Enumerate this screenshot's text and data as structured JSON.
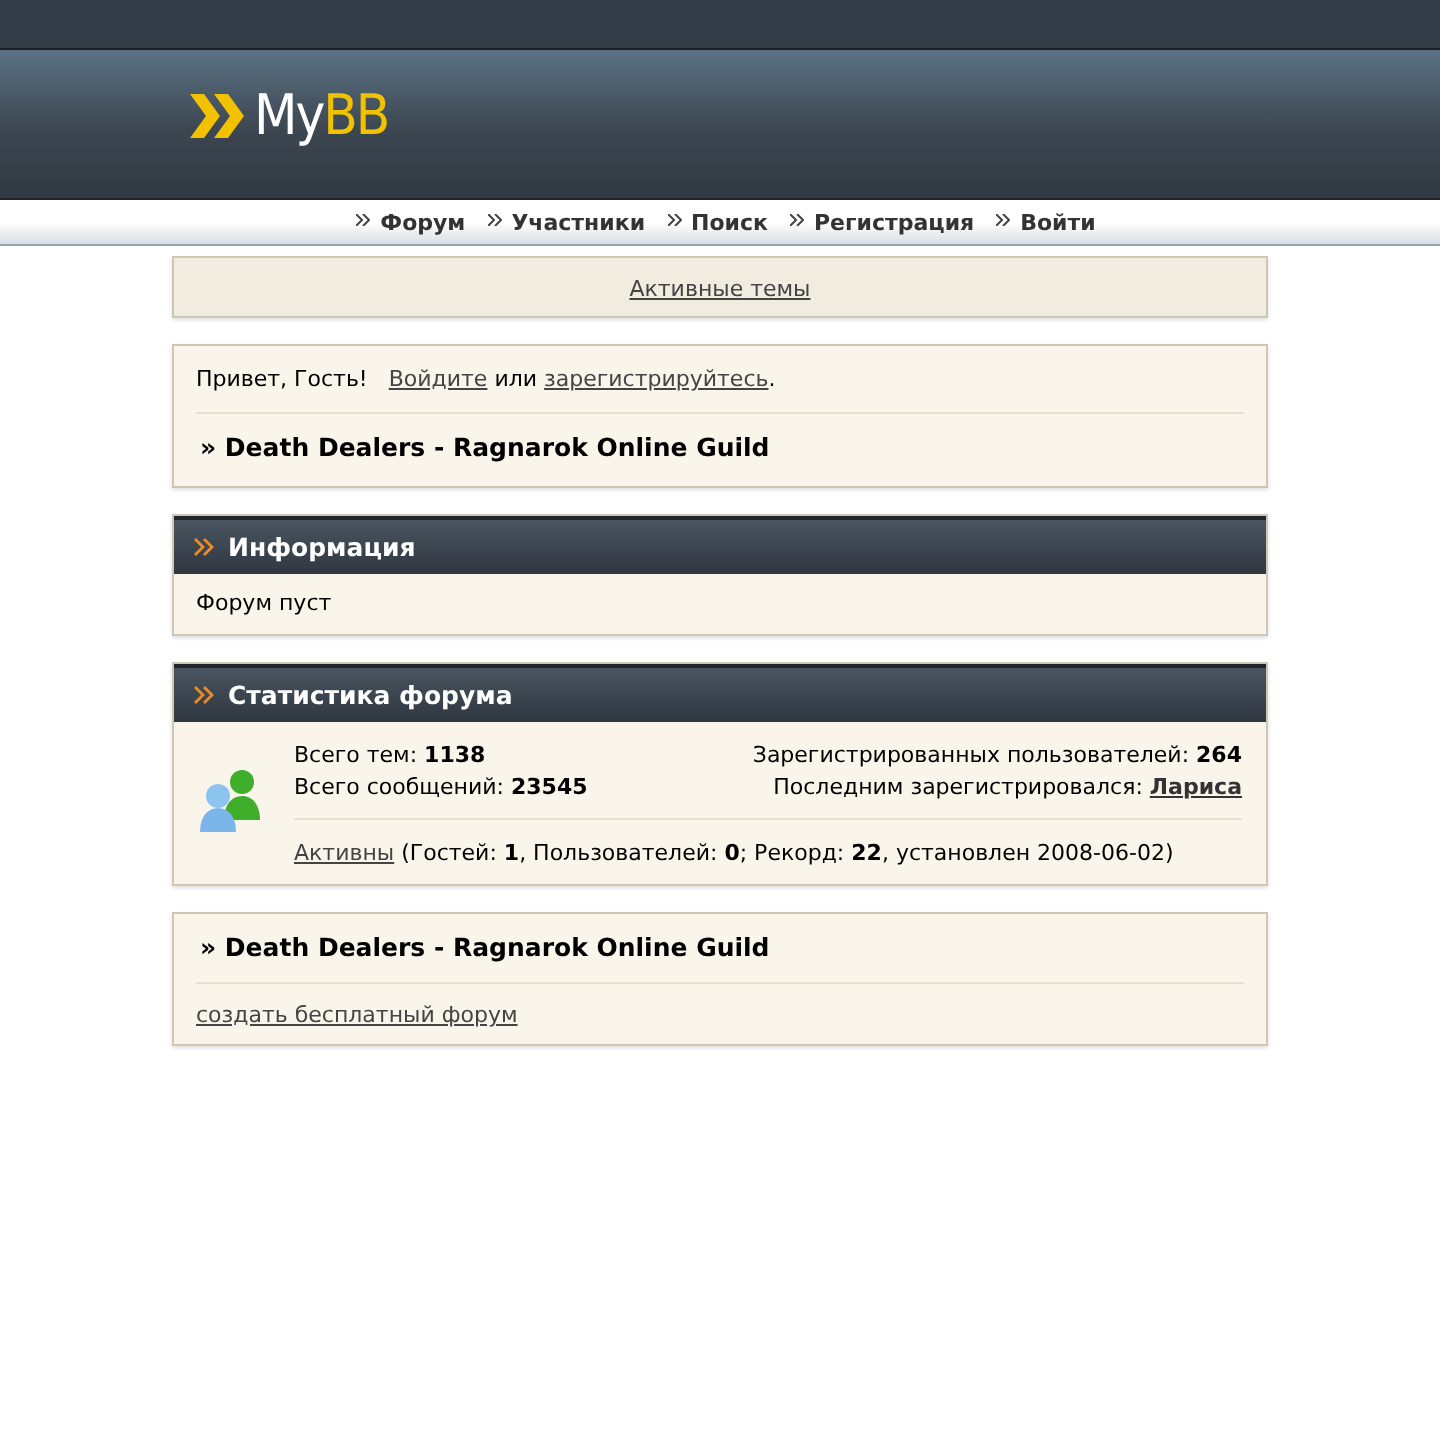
{
  "logo": {
    "text_1": "My",
    "text_2": "BB"
  },
  "nav": [
    {
      "label": "Форум"
    },
    {
      "label": "Участники"
    },
    {
      "label": "Поиск"
    },
    {
      "label": "Регистрация"
    },
    {
      "label": "Войти"
    }
  ],
  "active_topics_link": "Активные темы",
  "welcome": {
    "greeting": "Привет, Гость!",
    "login_link": "Войдите",
    "middle": " или ",
    "register_link": "зарегистрируйтесь",
    "end": ".",
    "breadcrumb": "» Death Dealers - Ragnarok Online Guild"
  },
  "info": {
    "title": "Информация",
    "text": "Форум пуст"
  },
  "stats": {
    "title": "Статистика форума",
    "left": [
      "Всего тем: **1138**",
      "Всего сообщений: **23545**"
    ],
    "registered": "Зарегистрированных пользователей: **264**",
    "last_label": "Последним зарегистрировался: ",
    "last_user": "Лариса",
    "online_link": "Активны",
    "online_text": " (Гостей: **1**, Пользователей: **0**; Рекорд: **22**, установлен 2008-06-02)"
  },
  "footer": {
    "breadcrumb": "» Death Dealers - Ragnarok Online Guild",
    "link": "создать бесплатный форум"
  }
}
